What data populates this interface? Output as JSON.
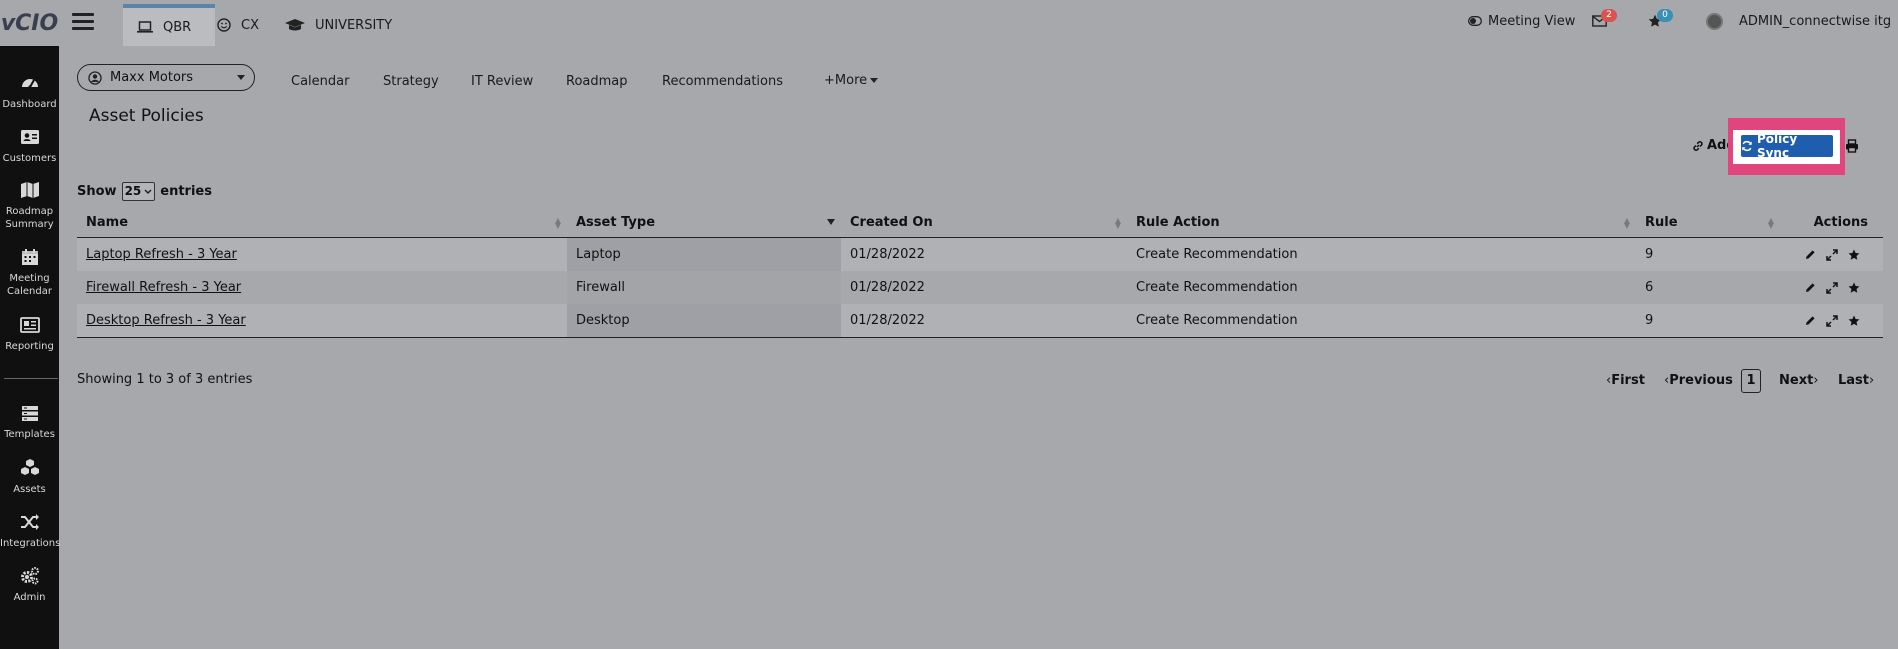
{
  "app": {
    "logo_text": "vCIO",
    "tabs": [
      {
        "label": "QBR",
        "icon": "laptop-icon",
        "active": true
      },
      {
        "label": "CX",
        "icon": "smiley-icon",
        "active": false
      },
      {
        "label": "UNIVERSITY",
        "icon": "graduation-cap-icon",
        "active": false
      }
    ],
    "meeting_view_label": "Meeting View",
    "mail_badge": "2",
    "star_badge": "0",
    "user_name": "ADMIN_connectwise itg",
    "colors": {
      "accent": "#5f82a6",
      "mail_badge": "#d9534f",
      "star_badge": "#3a8fb7",
      "sync_button": "#1f5eae",
      "highlight": "#e0457c"
    }
  },
  "sidebar": {
    "items": [
      {
        "label": "Dashboard",
        "icon": "dashboard-icon"
      },
      {
        "label": "Customers",
        "icon": "customers-icon"
      },
      {
        "label": "Roadmap Summary",
        "icon": "map-icon"
      },
      {
        "label": "Meeting Calendar",
        "icon": "calendar-icon"
      },
      {
        "label": "Reporting",
        "icon": "report-icon"
      },
      {
        "label": "Templates",
        "icon": "templates-icon"
      },
      {
        "label": "Assets",
        "icon": "cubes-icon"
      },
      {
        "label": "Integrations",
        "icon": "shuffle-icon"
      },
      {
        "label": "Admin",
        "icon": "gears-icon"
      }
    ]
  },
  "client": {
    "selected": "Maxx Motors"
  },
  "subnav": [
    "Calendar",
    "Strategy",
    "IT Review",
    "Roadmap",
    "Recommendations",
    "+More"
  ],
  "page": {
    "title": "Asset Policies",
    "add_label": "Add",
    "sync_label": "Policy Sync"
  },
  "table": {
    "show_label": "Show",
    "page_size": "25",
    "entries_label": "entries",
    "columns": [
      "Name",
      "Asset Type",
      "Created On",
      "Rule Action",
      "Rule",
      "Actions"
    ],
    "rows": [
      {
        "name": "Laptop Refresh - 3 Year",
        "asset_type": "Laptop",
        "created_on": "01/28/2022",
        "rule_action": "Create Recommendation",
        "rule": "9"
      },
      {
        "name": "Firewall Refresh - 3 Year",
        "asset_type": "Firewall",
        "created_on": "01/28/2022",
        "rule_action": "Create Recommendation",
        "rule": "6"
      },
      {
        "name": "Desktop Refresh - 3 Year",
        "asset_type": "Desktop",
        "created_on": "01/28/2022",
        "rule_action": "Create Recommendation",
        "rule": "9"
      }
    ]
  },
  "pagination": {
    "summary": "Showing 1 to 3 of 3 entries",
    "first": "First",
    "previous": "Previous",
    "current": "1",
    "next": "Next",
    "last": "Last"
  }
}
